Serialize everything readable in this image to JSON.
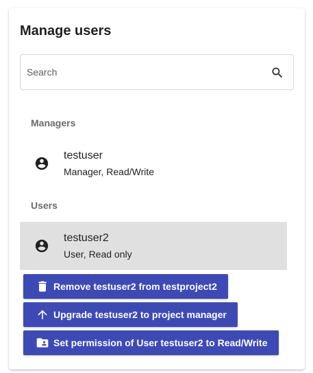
{
  "title": "Manage users",
  "search": {
    "placeholder": "Search",
    "value": "",
    "icon": "search-icon"
  },
  "sections": {
    "managers_label": "Managers",
    "users_label": "Users"
  },
  "managers": [
    {
      "name": "testuser",
      "role": "Manager, Read/Write",
      "icon": "account-circle-icon"
    }
  ],
  "users": [
    {
      "name": "testuser2",
      "role": "User, Read only",
      "icon": "account-circle-icon",
      "selected": true
    }
  ],
  "actions": {
    "remove_label": "Remove testuser2 from testproject2",
    "upgrade_label": "Upgrade testuser2 to project manager",
    "permission_label": "Set permission of User testuser2 to Read/Write"
  },
  "colors": {
    "accent": "#3d4ab5",
    "selected_row": "#e0e0e0",
    "section_label": "#6b6b6b"
  }
}
